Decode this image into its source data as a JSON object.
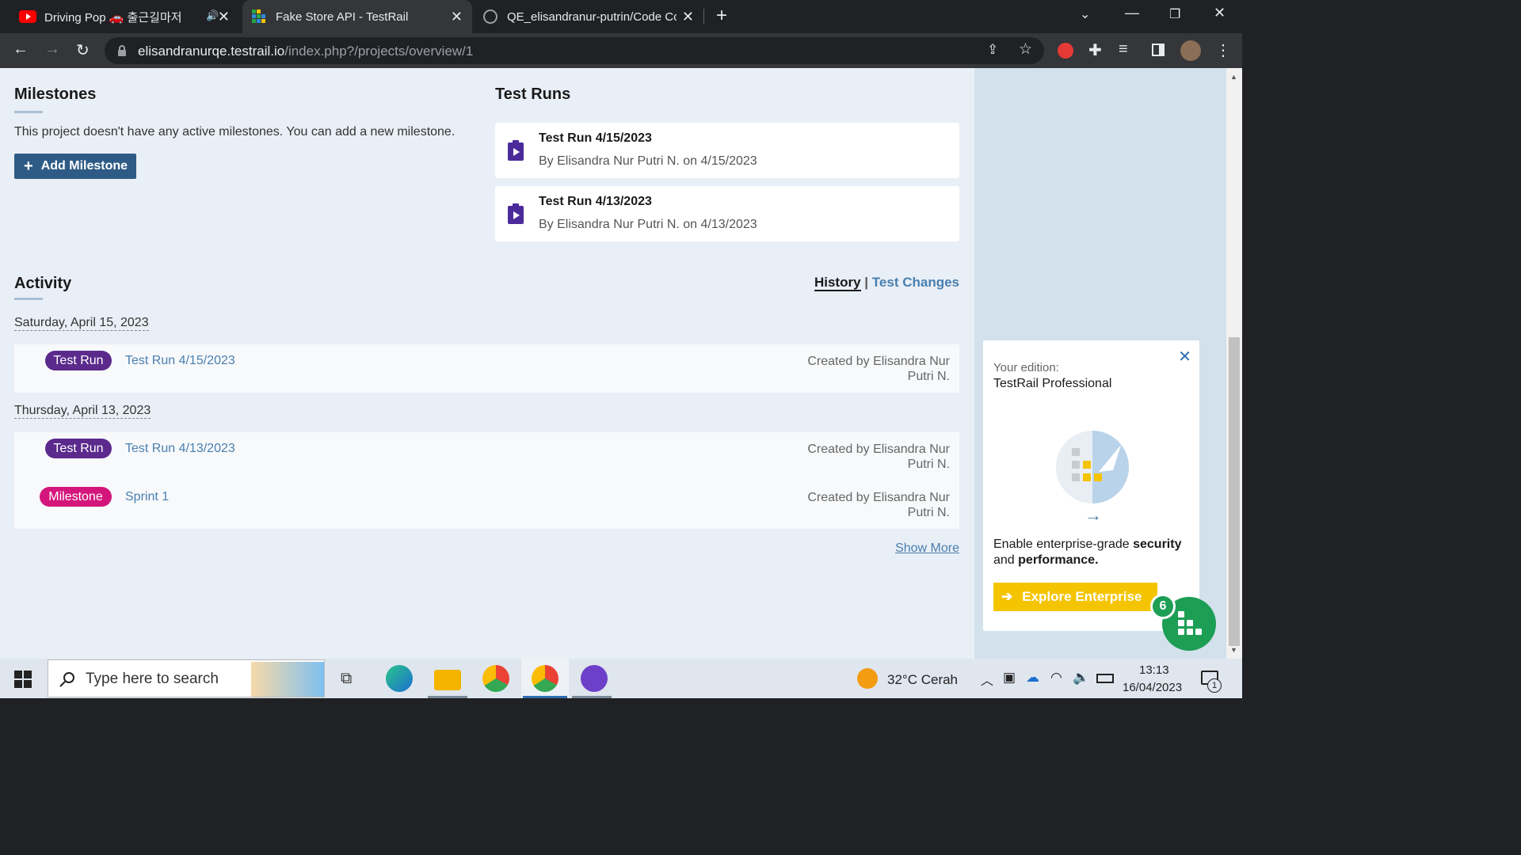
{
  "browser": {
    "tabs": [
      {
        "title": "Driving Pop 🚗 출근길마저 ",
        "audio": true
      },
      {
        "title": "Fake Store API - TestRail",
        "active": true
      },
      {
        "title": "QE_elisandranur-putrin/Code Co"
      }
    ],
    "url_host": "elisandranurqe.testrail.io",
    "url_path": "/index.php?/projects/overview/1"
  },
  "milestones": {
    "heading": "Milestones",
    "empty_text": "This project doesn't have any active milestones. You can add a new milestone.",
    "add_label": "Add Milestone"
  },
  "test_runs": {
    "heading": "Test Runs",
    "items": [
      {
        "title": "Test Run 4/15/2023",
        "subtitle": "By Elisandra Nur Putri N. on 4/15/2023"
      },
      {
        "title": "Test Run 4/13/2023",
        "subtitle": "By Elisandra Nur Putri N. on 4/13/2023"
      }
    ]
  },
  "activity": {
    "heading": "Activity",
    "tab_history": "History",
    "separator": "|",
    "tab_changes": "Test Changes",
    "groups": [
      {
        "date": "Saturday, April 15, 2023",
        "rows": [
          {
            "badge": "Test Run",
            "link": "Test Run 4/15/2023",
            "by1": "Created by Elisandra Nur",
            "by2": "Putri N."
          }
        ]
      },
      {
        "date": "Thursday, April 13, 2023",
        "rows": [
          {
            "badge": "Test Run",
            "link": "Test Run 4/13/2023",
            "by1": "Created by Elisandra Nur",
            "by2": "Putri N."
          },
          {
            "badge": "Milestone",
            "link": "Sprint 1",
            "by1": "Created by Elisandra Nur",
            "by2": "Putri N."
          }
        ]
      }
    ],
    "show_more": "Show More"
  },
  "promo": {
    "edition_label": "Your edition:",
    "edition": "TestRail Professional",
    "text_1": "Enable enterprise-grade ",
    "text_bold_1": "security",
    "text_2": "and ",
    "text_bold_2": "performance.",
    "button": "Explore Enterprise",
    "fab_count": "6"
  },
  "colors": {
    "testrun_badge": "#5b2a8c",
    "milestone_badge": "#d4157b",
    "accent": "#2e5b85",
    "explore": "#f5c400"
  },
  "taskbar": {
    "search_placeholder": "Type here to search",
    "weather": "32°C  Cerah",
    "time": "13:13",
    "date": "16/04/2023",
    "notif_count": "1"
  }
}
